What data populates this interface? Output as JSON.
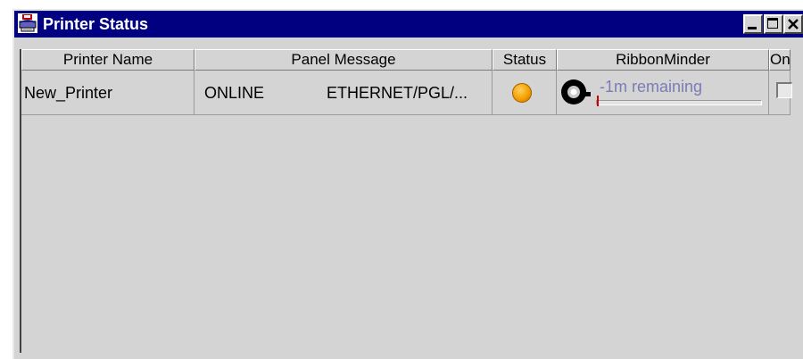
{
  "window": {
    "title": "Printer Status"
  },
  "columns": [
    "Printer Name",
    "Panel Message",
    "Status",
    "RibbonMinder",
    "On"
  ],
  "rows": [
    {
      "printer_name": "New_Printer",
      "panel_state": "ONLINE",
      "panel_detail": "ETHERNET/PGL/...",
      "status_color": "#f5a000",
      "ribbon_text": "-1m remaining",
      "ribbon_progress": 0,
      "on": false
    }
  ],
  "colors": {
    "titlebar": "#000080",
    "window_bg": "#d4d4d4",
    "ribbon_text": "#7b7bb5"
  }
}
